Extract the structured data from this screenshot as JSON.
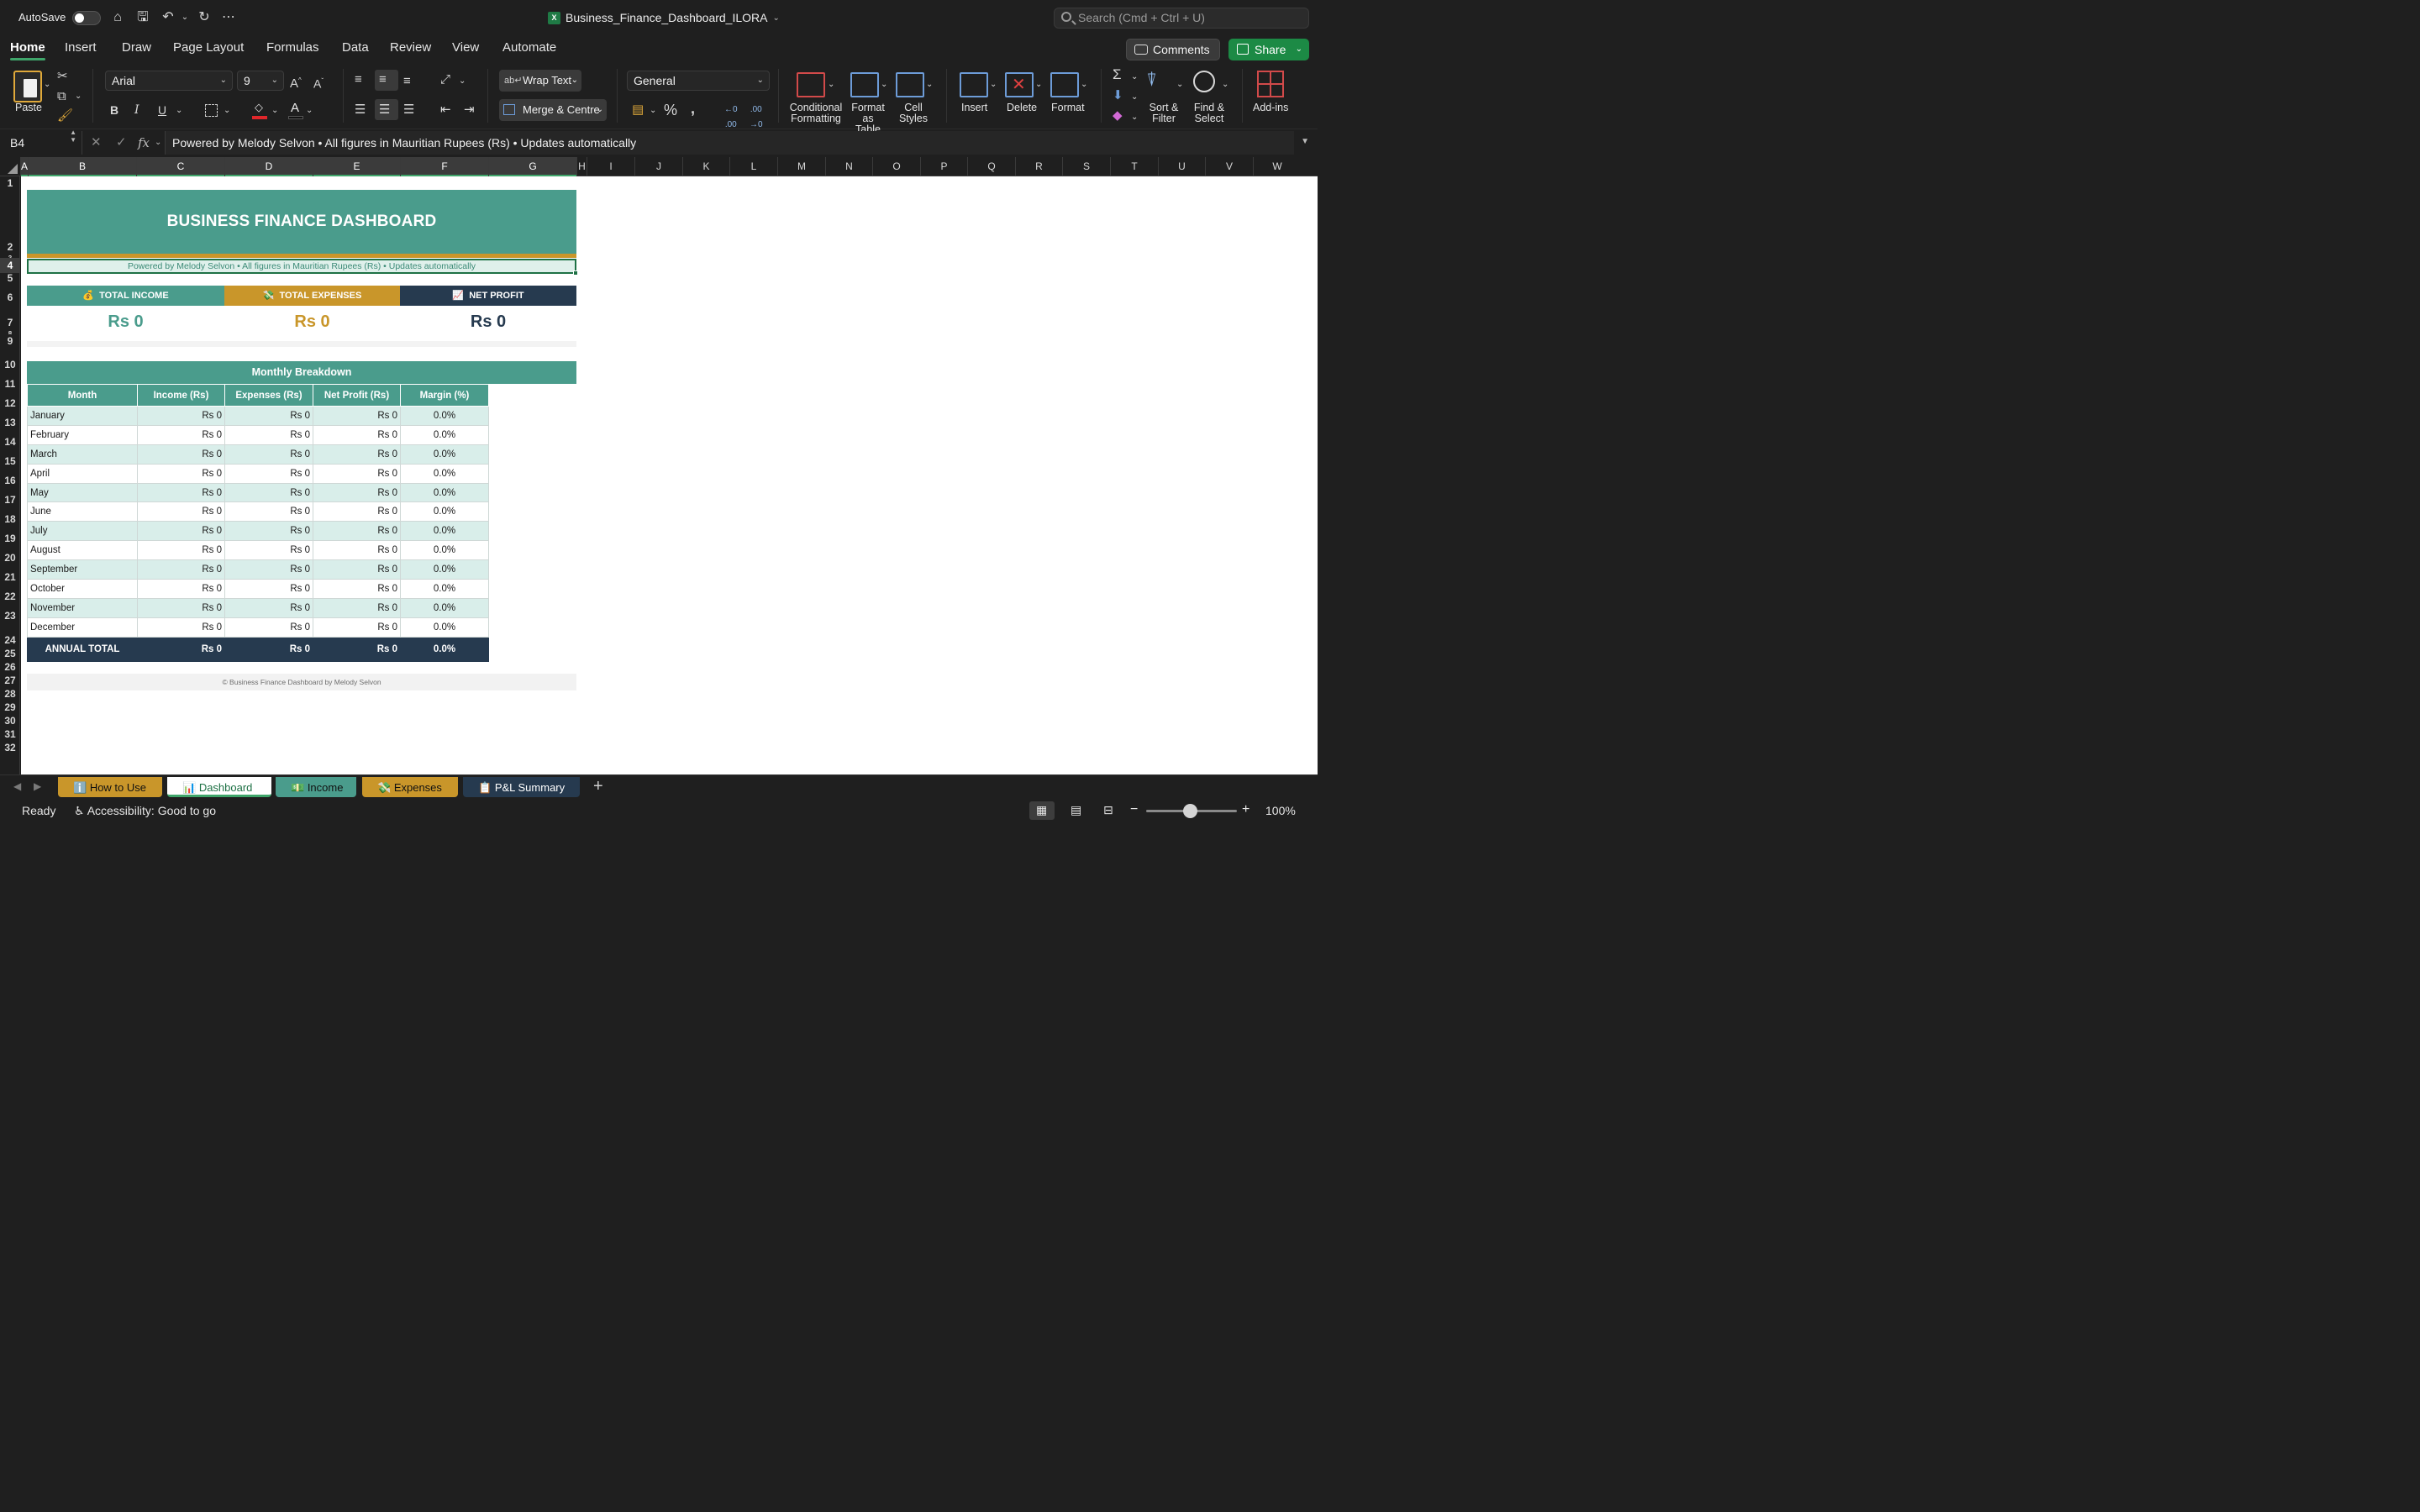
{
  "titlebar": {
    "autosave_label": "AutoSave",
    "doc_title": "Business_Finance_Dashboard_ILORA",
    "search_placeholder": "Search (Cmd + Ctrl + U)"
  },
  "ribbon_tabs": [
    "Home",
    "Insert",
    "Draw",
    "Page Layout",
    "Formulas",
    "Data",
    "Review",
    "View",
    "Automate"
  ],
  "actions": {
    "comments": "Comments",
    "share": "Share"
  },
  "ribbon": {
    "paste": "Paste",
    "font_name": "Arial",
    "font_size": "9",
    "bold": "B",
    "italic": "I",
    "underline": "U",
    "wrap_text": "Wrap Text",
    "merge_centre": "Merge & Centre",
    "number_format": "General",
    "conditional_formatting": [
      "Conditional",
      "Formatting"
    ],
    "format_as_table": [
      "Format",
      "as Table"
    ],
    "cell_styles": [
      "Cell",
      "Styles"
    ],
    "insert": "Insert",
    "delete": "Delete",
    "format": "Format",
    "sort_filter": [
      "Sort &",
      "Filter"
    ],
    "find_select": [
      "Find &",
      "Select"
    ],
    "add_ins": "Add-ins"
  },
  "formula_bar": {
    "name_box": "B4",
    "fx": "fx",
    "formula": "Powered by Melody Selvon  •  All figures in Mauritian Rupees (Rs)  •  Updates automatically"
  },
  "columns": [
    "A",
    "B",
    "C",
    "D",
    "E",
    "F",
    "G",
    "H",
    "I",
    "J",
    "K",
    "L",
    "M",
    "N",
    "O",
    "P",
    "Q",
    "R",
    "S",
    "T",
    "U",
    "V",
    "W"
  ],
  "rows": [
    "1",
    "2",
    "3",
    "4",
    "5",
    "6",
    "7",
    "8",
    "9",
    "10",
    "11",
    "12",
    "13",
    "14",
    "15",
    "16",
    "17",
    "18",
    "19",
    "20",
    "21",
    "22",
    "23",
    "24",
    "25",
    "26",
    "27",
    "28",
    "29",
    "30",
    "31",
    "32"
  ],
  "dashboard": {
    "title": "BUSINESS FINANCE DASHBOARD",
    "subtitle": "Powered by Melody Selvon  •  All figures in Mauritian Rupees (Rs)  •  Updates automatically",
    "kpis": [
      {
        "icon": "💰",
        "label": "TOTAL INCOME",
        "value": "Rs 0",
        "color": "#4a9c8c"
      },
      {
        "icon": "💸",
        "label": "TOTAL EXPENSES",
        "value": "Rs 0",
        "color": "#c9962a"
      },
      {
        "icon": "📈",
        "label": "NET PROFIT",
        "value": "Rs 0",
        "color": "#263a4f"
      }
    ],
    "breakdown_title": "Monthly Breakdown",
    "table_headers": [
      "Month",
      "Income (Rs)",
      "Expenses (Rs)",
      "Net Profit (Rs)",
      "Margin (%)"
    ],
    "table_rows": [
      [
        "January",
        "Rs 0",
        "Rs 0",
        "Rs 0",
        "0.0%"
      ],
      [
        "February",
        "Rs 0",
        "Rs 0",
        "Rs 0",
        "0.0%"
      ],
      [
        "March",
        "Rs 0",
        "Rs 0",
        "Rs 0",
        "0.0%"
      ],
      [
        "April",
        "Rs 0",
        "Rs 0",
        "Rs 0",
        "0.0%"
      ],
      [
        "May",
        "Rs 0",
        "Rs 0",
        "Rs 0",
        "0.0%"
      ],
      [
        "June",
        "Rs 0",
        "Rs 0",
        "Rs 0",
        "0.0%"
      ],
      [
        "July",
        "Rs 0",
        "Rs 0",
        "Rs 0",
        "0.0%"
      ],
      [
        "August",
        "Rs 0",
        "Rs 0",
        "Rs 0",
        "0.0%"
      ],
      [
        "September",
        "Rs 0",
        "Rs 0",
        "Rs 0",
        "0.0%"
      ],
      [
        "October",
        "Rs 0",
        "Rs 0",
        "Rs 0",
        "0.0%"
      ],
      [
        "November",
        "Rs 0",
        "Rs 0",
        "Rs 0",
        "0.0%"
      ],
      [
        "December",
        "Rs 0",
        "Rs 0",
        "Rs 0",
        "0.0%"
      ]
    ],
    "total_row": [
      "ANNUAL TOTAL",
      "Rs 0",
      "Rs 0",
      "Rs 0",
      "0.0%"
    ],
    "footer": "© Business Finance Dashboard by Melody Selvon"
  },
  "sheet_tabs": [
    {
      "icon": "ℹ️",
      "label": "How to Use",
      "color": "#c9962a",
      "active": false
    },
    {
      "icon": "📊",
      "label": "Dashboard",
      "color": "#ffffff",
      "active": true
    },
    {
      "icon": "💵",
      "label": "Income",
      "color": "#4a9c8c",
      "active": false
    },
    {
      "icon": "💸",
      "label": "Expenses",
      "color": "#c9962a",
      "active": false
    },
    {
      "icon": "📋",
      "label": "P&L Summary",
      "color": "#263a4f",
      "active": false
    }
  ],
  "status": {
    "ready": "Ready",
    "accessibility": "Accessibility: Good to go",
    "zoom": "100%"
  }
}
